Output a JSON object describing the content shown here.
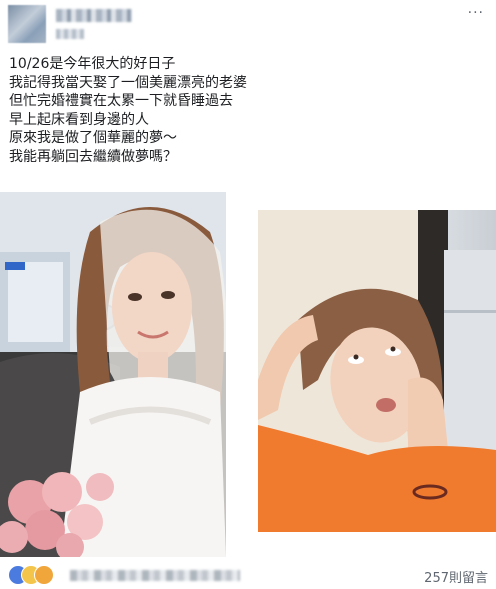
{
  "post": {
    "more_label": "···",
    "lines": [
      "10/26是今年很大的好日子",
      "我記得我當天娶了一個美麗漂亮的老婆",
      "但忙完婚禮實在太累一下就昏睡過去",
      "早上起床看到身邊的人",
      "原來我是做了個華麗的夢～",
      "我能再躺回去繼續做夢嗎？"
    ]
  },
  "footer": {
    "comment_count": "257則留言"
  },
  "icons": {
    "more": "more-horizontal-icon",
    "like": "like-reaction-icon",
    "haha": "haha-reaction-icon",
    "wow": "wow-reaction-icon"
  },
  "colors": {
    "text": "#1c1e21",
    "secondary": "#606770",
    "like_blue": "#4c7be0",
    "haha_yellow": "#f3c54a"
  }
}
